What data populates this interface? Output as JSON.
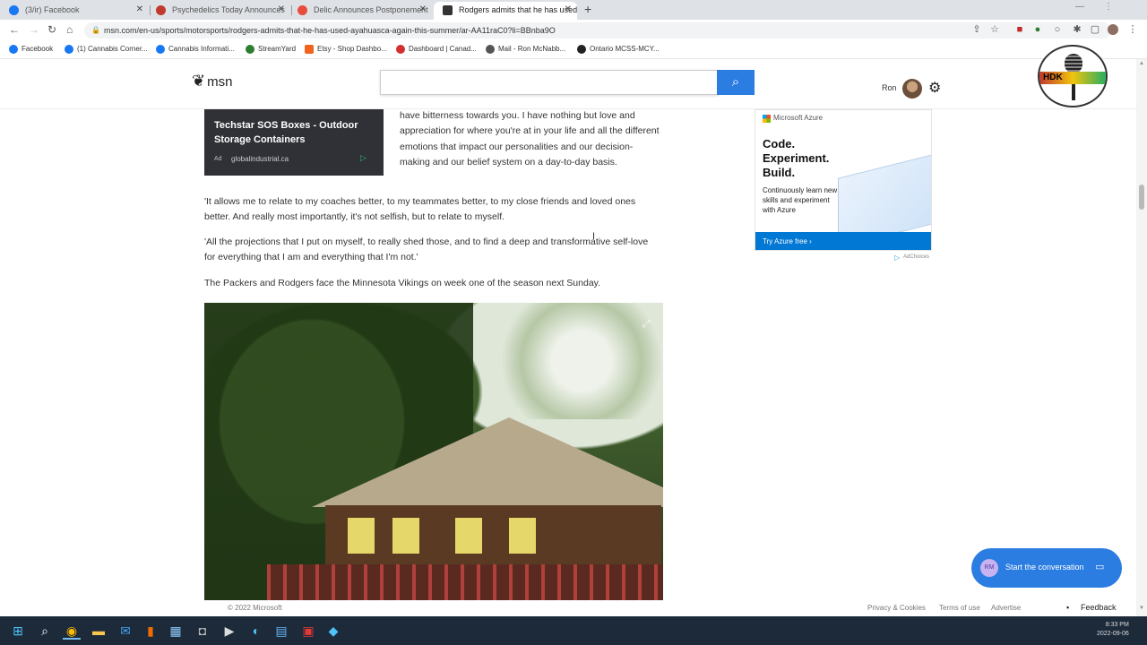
{
  "browser": {
    "tabs": [
      {
        "label": "(3/ir) Facebook",
        "color": "#1877f2"
      },
      {
        "label": "Psychedelics Today Announces",
        "color": "#c0392b"
      },
      {
        "label": "Delic Announces Postponement",
        "color": "#e74c3c"
      },
      {
        "label": "Rodgers admits that he has used",
        "color": "#333333"
      }
    ],
    "new_tab": "+",
    "url": "msn.com/en-us/sports/motorsports/rodgers-admits-that-he-has-used-ayahuasca-again-this-summer/ar-AA11raC0?li=BBnba9O",
    "bookmarks": [
      {
        "label": "Facebook",
        "color": "#1877f2"
      },
      {
        "label": "(1) Cannabis Corner...",
        "color": "#1877f2"
      },
      {
        "label": "Cannabis Informati...",
        "color": "#1877f2"
      },
      {
        "label": "StreamYard",
        "color": "#2e7d32"
      },
      {
        "label": "Etsy - Shop Dashbo...",
        "color": "#f1641e"
      },
      {
        "label": "Dashboard | Canad...",
        "color": "#d32f2f"
      },
      {
        "label": "Mail - Ron McNabb...",
        "color": "#555555"
      },
      {
        "label": "Ontario MCSS-MCY...",
        "color": "#222222"
      }
    ]
  },
  "msn": {
    "logo": "msn",
    "search_placeholder": "",
    "user_name": "Ron",
    "podcast_logo_text": "HDK"
  },
  "ad_card": {
    "title": "Techstar SOS Boxes - Outdoor Storage Containers",
    "tag": "Ad",
    "domain": "globalindustrial.ca"
  },
  "article": {
    "quote_top": "have bitterness towards you. I have nothing but love and appreciation for where you're at in your life and all the different emotions that impact our personalities and our decision-making and our belief system on a day-to-day basis.",
    "paragraphs": [
      "'It allows me to relate to my coaches better, to my teammates better, to my close friends and loved ones better. And really most importantly, it's not selfish, but to relate to myself.",
      "'All the projections that I put on myself, to really shed those, and to find a deep and transformative self-love for everything that I am and everything that I'm not.'",
      "The Packers and Rodgers face the Minnesota Vikings on week one of the season next Sunday."
    ]
  },
  "azure_ad": {
    "brand": "Microsoft Azure",
    "headline": "Code.\nExperiment.\nBuild.",
    "sub": "Continuously learn new skills and experiment with Azure",
    "cta": "Try Azure free ›",
    "adchoices": "AdChoices"
  },
  "footer": {
    "copyright": "© 2022 Microsoft",
    "links": [
      "Privacy & Cookies",
      "Terms of use",
      "Advertise"
    ],
    "feedback": "Feedback"
  },
  "chat": {
    "avatar": "RM",
    "label": "Start the conversation"
  },
  "taskbar": {
    "time": "8:33 PM",
    "date": "2022-09-06"
  }
}
